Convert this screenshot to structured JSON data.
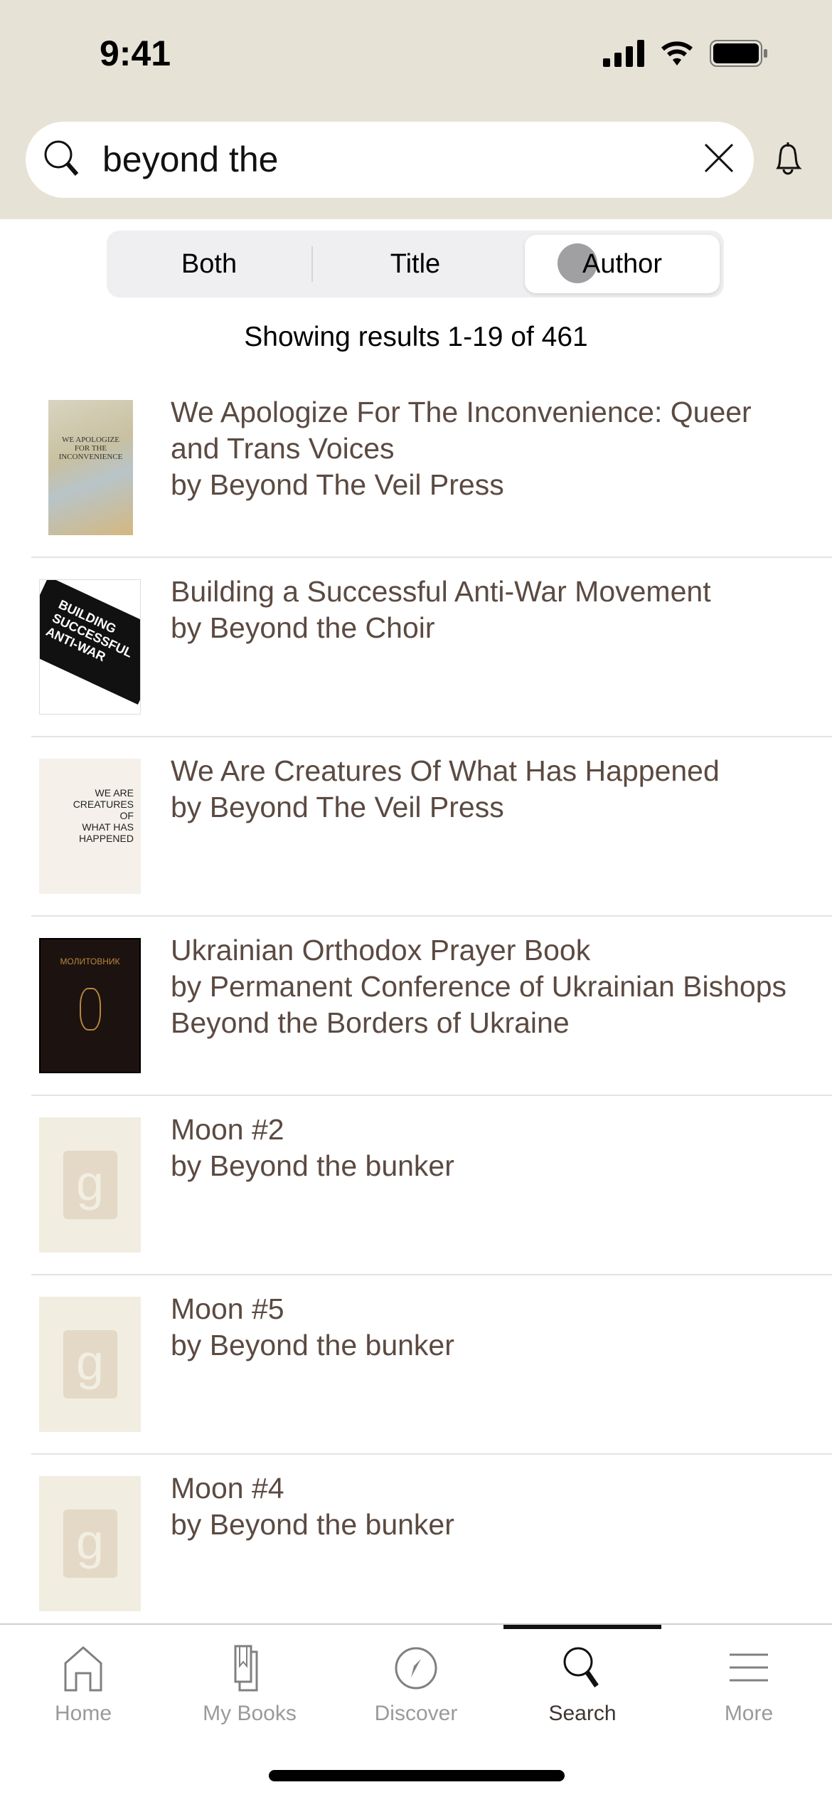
{
  "status_bar": {
    "time": "9:41"
  },
  "search": {
    "query": "beyond the"
  },
  "filter": {
    "options": [
      "Both",
      "Title",
      "Author"
    ],
    "selected": "Author"
  },
  "results_count": "Showing results 1-19 of 461",
  "results": [
    {
      "title": "We Apologize For The Inconvenience: Queer and Trans Voices",
      "author": "by Beyond The Veil Press",
      "cover": "image"
    },
    {
      "title": "Building a Successful Anti-War Movement",
      "author": "by Beyond the Choir",
      "cover": "image"
    },
    {
      "title": "We Are Creatures Of What Has Happened",
      "author": "by Beyond The Veil Press",
      "cover": "image"
    },
    {
      "title": "Ukrainian Orthodox Prayer Book",
      "author": "by Permanent Conference of Ukrainian Bishops Beyond the Borders of Ukraine",
      "cover": "image"
    },
    {
      "title": "Moon #2",
      "author": "by Beyond the bunker",
      "cover": "placeholder"
    },
    {
      "title": "Moon #5",
      "author": "by Beyond the bunker",
      "cover": "placeholder"
    },
    {
      "title": "Moon #4",
      "author": "by Beyond the bunker",
      "cover": "placeholder"
    }
  ],
  "tabs": [
    {
      "label": "Home",
      "icon": "home-icon"
    },
    {
      "label": "My Books",
      "icon": "books-icon"
    },
    {
      "label": "Discover",
      "icon": "compass-icon"
    },
    {
      "label": "Search",
      "icon": "search-icon",
      "active": true
    },
    {
      "label": "More",
      "icon": "menu-icon"
    }
  ],
  "colors": {
    "header_bg": "#e6e2d6",
    "text_brown": "#5b4a42",
    "placeholder_bg": "#f1ede0"
  }
}
